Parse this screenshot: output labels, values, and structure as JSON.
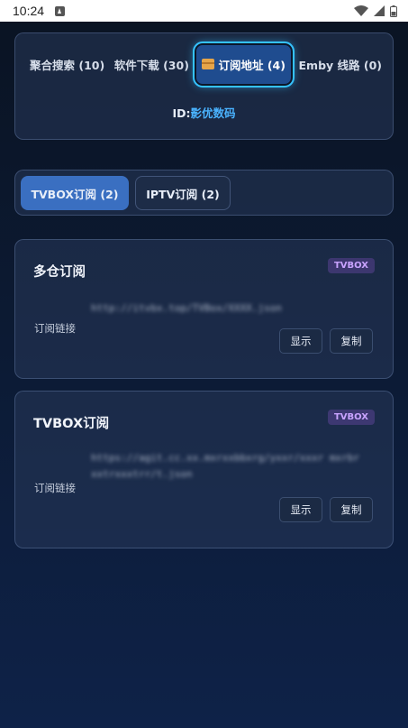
{
  "status_bar": {
    "time": "10:24"
  },
  "top_tabs": [
    {
      "label": "聚合搜索 (10)"
    },
    {
      "label": "软件下载 (30)"
    },
    {
      "label": "订阅地址 (4)",
      "active": true
    },
    {
      "label": "Emby 线路 (0)"
    }
  ],
  "id_line": {
    "prefix": "ID:",
    "value": "影优数码"
  },
  "sub_tabs": [
    {
      "label": "TVBOX订阅 (2)",
      "active": true
    },
    {
      "label": "IPTV订阅 (2)"
    }
  ],
  "subscriptions": [
    {
      "title": "多仓订阅",
      "badge": "TVBOX",
      "link_label": "订阅链接",
      "url": "http://itvbx.top/TVBox/XXXX.json",
      "show_label": "显示",
      "copy_label": "复制"
    },
    {
      "title": "TVBOX订阅",
      "badge": "TVBOX",
      "link_label": "订阅链接",
      "url": "https://agit.cc.xx.mxrxxbbxrg/yxxr/xxxr mxrbrxxtrxxxtrr/t.json",
      "show_label": "显示",
      "copy_label": "复制"
    }
  ],
  "colors": {
    "accent": "#35c2ff",
    "active_tab": "#3a6fc1",
    "badge_text": "#c9a3ff",
    "id_value": "#4ab3ff"
  },
  "icons": [
    "signal-icon",
    "wifi-icon",
    "battery-icon",
    "package-icon",
    "notification-icon"
  ]
}
